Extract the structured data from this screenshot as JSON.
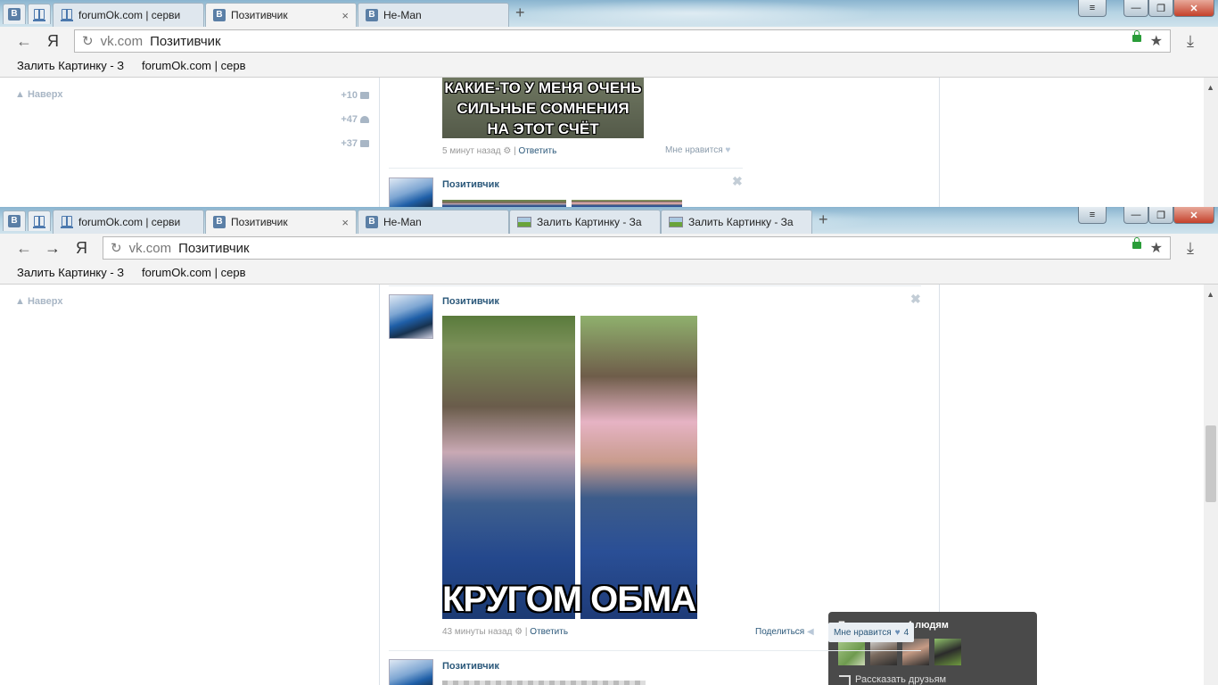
{
  "browser": {
    "back_icon": "back-arrow-icon",
    "forward_icon": "forward-arrow-icon",
    "yandex_logo": "Я",
    "reload_icon": "↻",
    "url_host": "vk.com",
    "url_page": "Позитивчик",
    "star_icon": "★",
    "download_icon": "⤓",
    "new_tab": "+",
    "win_minimize": "—",
    "win_maximize": "❐",
    "win_close": "✕",
    "menu_icon": "≡"
  },
  "win1": {
    "tabs": [
      {
        "label": "forumOk.com | серви"
      },
      {
        "label": "Позитивчик",
        "close": "×"
      },
      {
        "label": "He-Man"
      }
    ],
    "bookmarks": [
      "Залить Картинку - З",
      "forumOk.com | серв"
    ]
  },
  "win2": {
    "tabs": [
      {
        "label": "forumOk.com | серви"
      },
      {
        "label": "Позитивчик",
        "close": "×"
      },
      {
        "label": "He-Man"
      },
      {
        "label": "Залить Картинку - За"
      },
      {
        "label": "Залить Картинку - За"
      }
    ],
    "bookmarks": [
      "Залить Картинку - З",
      "forumOk.com | серв"
    ]
  },
  "page": {
    "naverh": "Наверх",
    "counters": [
      "+10",
      "+47",
      "+37"
    ]
  },
  "post1": {
    "image_text": [
      "КАКИЕ-ТО У МЕНЯ ОЧЕНЬ",
      "СИЛЬНЫЕ СОМНЕНИЯ",
      "НА ЭТОТ СЧЁТ"
    ],
    "time": "5 минут назад",
    "reply": "Ответить",
    "like": "Мне нравится"
  },
  "post2": {
    "author": "Позитивчик"
  },
  "post3": {
    "author": "Позитивчик",
    "image_text": "КРУГОМ ОБМАН",
    "time": "43 минуты назад",
    "reply": "Ответить",
    "share": "Поделиться",
    "like": "Мне нравится",
    "like_count": "4"
  },
  "popup": {
    "title": "Понравилось 4 людям",
    "share": "Рассказать друзьям"
  },
  "post4": {
    "author": "Позитивчик"
  }
}
